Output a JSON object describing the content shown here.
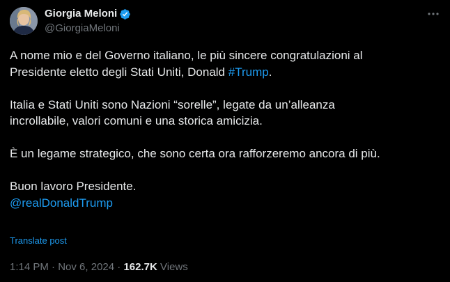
{
  "author": {
    "display_name": "Giorgia Meloni",
    "handle": "@GiorgiaMeloni",
    "verified": true,
    "verified_color": "#1d9bf0"
  },
  "post": {
    "line1": "A nome mio e del Governo italiano, le più sincere congratulazioni al",
    "line2_text": "Presidente eletto degli Stati Uniti, Donald ",
    "line2_hashtag": "#Trump",
    "line2_end": ".",
    "line3": "Italia e Stati Uniti sono Nazioni “sorelle”, legate da un’alleanza",
    "line4": "incrollabile, valori comuni e una storica amicizia.",
    "line5": "È un legame strategico, che sono certa ora rafforzeremo ancora di più.",
    "line6": "Buon lavoro Presidente.",
    "mention": "@realDonaldTrump"
  },
  "translate_label": "Translate post",
  "meta": {
    "time": "1:14 PM",
    "date": "Nov 6, 2024",
    "views_count": "162.7K",
    "views_label": "Views"
  },
  "colors": {
    "background": "#000000",
    "text": "#e7e9ea",
    "secondary": "#71767b",
    "link": "#1d9bf0"
  },
  "icons": {
    "more": "more-horizontal-icon",
    "verified": "verified-badge-icon"
  }
}
